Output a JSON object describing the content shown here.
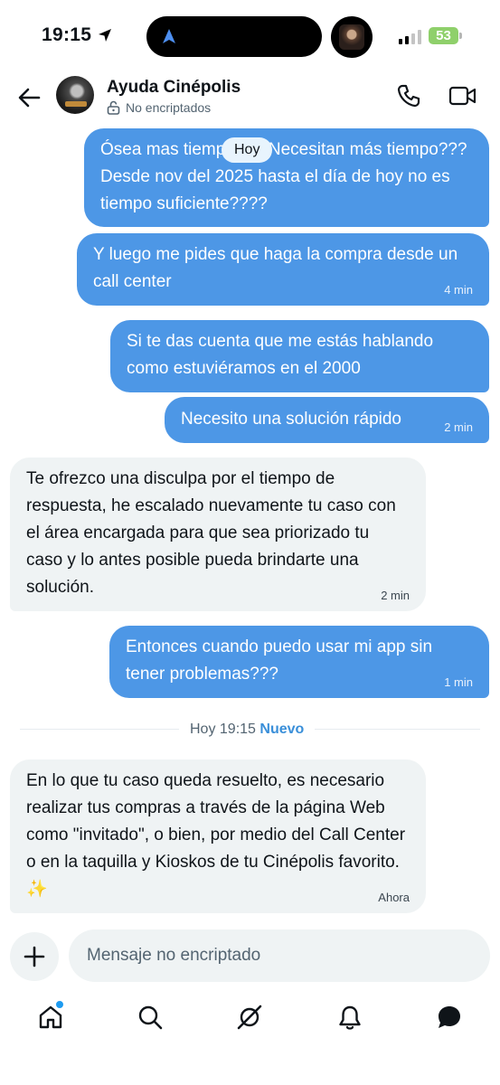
{
  "status_bar": {
    "time": "19:15",
    "battery": "53"
  },
  "header": {
    "title": "Ayuda Cinépolis",
    "encryption": "No encriptados"
  },
  "date_pill": "Hoy",
  "messages": [
    {
      "direction": "outgoing",
      "text": "Ósea mas tiempo??? Necesitan más tiempo??? Desde nov del 2025 hasta el día de hoy no es tiempo suficiente????",
      "time": ""
    },
    {
      "direction": "outgoing",
      "text": "Y luego me pides que haga la compra desde un call center",
      "time": "4 min"
    },
    {
      "direction": "outgoing",
      "text": "Si te das cuenta que me estás hablando como estuviéramos en el 2000",
      "time": ""
    },
    {
      "direction": "outgoing",
      "text": "Necesito una solución rápido",
      "time": "2 min"
    },
    {
      "direction": "incoming",
      "text": "Te ofrezco una disculpa por el tiempo de respuesta, he escalado nuevamente tu caso con el área encargada para que sea priorizado tu caso y lo antes posible pueda brindarte una solución.",
      "time": "2 min"
    },
    {
      "direction": "outgoing",
      "text": "Entonces cuando puedo usar mi app sin tener problemas???",
      "time": "1 min"
    },
    {
      "direction": "incoming",
      "text": "En lo que tu caso queda resuelto, es necesario realizar tus compras a través de la página Web como \"invitado\", o bien, por medio del Call Center o en la taquilla y Kioskos de tu Cinépolis favorito. ✨",
      "time": "Ahora"
    }
  ],
  "divider": {
    "time": "Hoy 19:15",
    "badge": "Nuevo"
  },
  "composer": {
    "placeholder": "Mensaje no encriptado"
  },
  "nav": [
    "home-icon",
    "search-icon",
    "grok-icon",
    "notifications-icon",
    "messages-icon"
  ],
  "colors": {
    "outgoing_bubble": "#4d97e6",
    "incoming_bubble": "#eff3f4",
    "accent": "#1d9bf0"
  }
}
